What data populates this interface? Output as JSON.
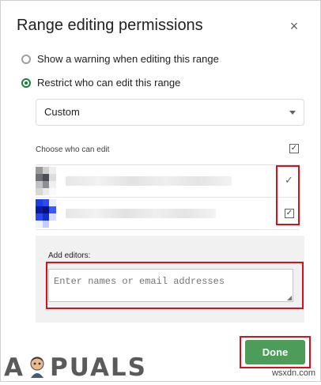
{
  "dialog": {
    "title": "Range editing permissions",
    "close_icon": "×"
  },
  "options": [
    {
      "label": "Show a warning when editing this range",
      "checked": false
    },
    {
      "label": "Restrict who can edit this range",
      "checked": true
    }
  ],
  "select": {
    "value": "Custom"
  },
  "editors": {
    "label": "Choose who can edit",
    "select_all_checked": true,
    "rows": [
      {
        "checked": true,
        "check_symbol": "✓"
      },
      {
        "checked": true,
        "check_symbol": "✓"
      }
    ]
  },
  "add_editors": {
    "label": "Add editors:",
    "placeholder": "Enter names or email addresses"
  },
  "buttons": {
    "done": "Done"
  },
  "watermark": {
    "left": "A",
    "right": "PUALS",
    "site": "wsxdn.com"
  },
  "colors": {
    "accent_green": "#188038",
    "done_bg": "#4d9c5a",
    "highlight_red": "#d9101a"
  }
}
